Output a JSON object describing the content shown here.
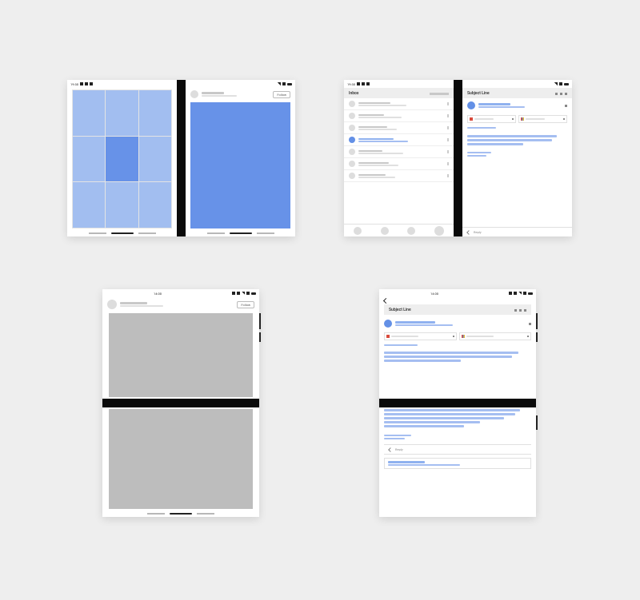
{
  "status": {
    "time": "19:30",
    "time_alt": "14:00"
  },
  "device1": {
    "profile_name_placeholder": "",
    "follow_label": "Follow"
  },
  "device2": {
    "inbox_title": "Inbox",
    "subject_title": "Subject Line",
    "reply_label": "Reply"
  },
  "device3": {
    "follow_label": "Follow"
  },
  "device4": {
    "subject_title": "Subject Line",
    "reply_label": "Reply"
  },
  "colors": {
    "accent": "#6792e8",
    "accent_light": "#a2bef0",
    "line_blue": "#a5bef1",
    "hinge": "#0a0a0a"
  }
}
